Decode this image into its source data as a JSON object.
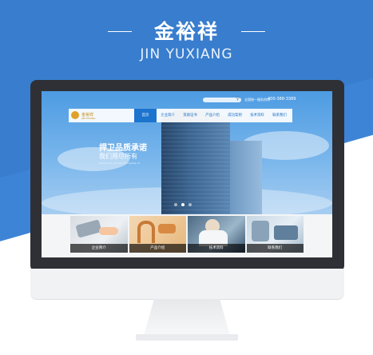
{
  "promo": {
    "title": "金裕祥",
    "subtitle": "JIN YUXIANG"
  },
  "site": {
    "logo_text": "金裕祥",
    "logo_sub": "JINYUXIANG",
    "hotline_label": "全国统一服务热线",
    "hotline_number": "400-388-3389",
    "nav": [
      "首页",
      "企业简介",
      "资质证书",
      "产品介绍",
      "成功案例",
      "技术资料",
      "联系我们"
    ],
    "active_nav": 0,
    "slogan_line1": "捍卫品质承诺",
    "slogan_line2": "我们用尽所有",
    "slogan_line3": "Defend the promise the quality of",
    "slide_count": 3,
    "active_slide": 1,
    "cards": [
      "企业简介",
      "产品介绍",
      "技术资料",
      "联系我们"
    ]
  },
  "colors": {
    "promo_blue": "#3d84d6",
    "nav_active": "#1d74cf",
    "logo_gold": "#e0a12a"
  }
}
